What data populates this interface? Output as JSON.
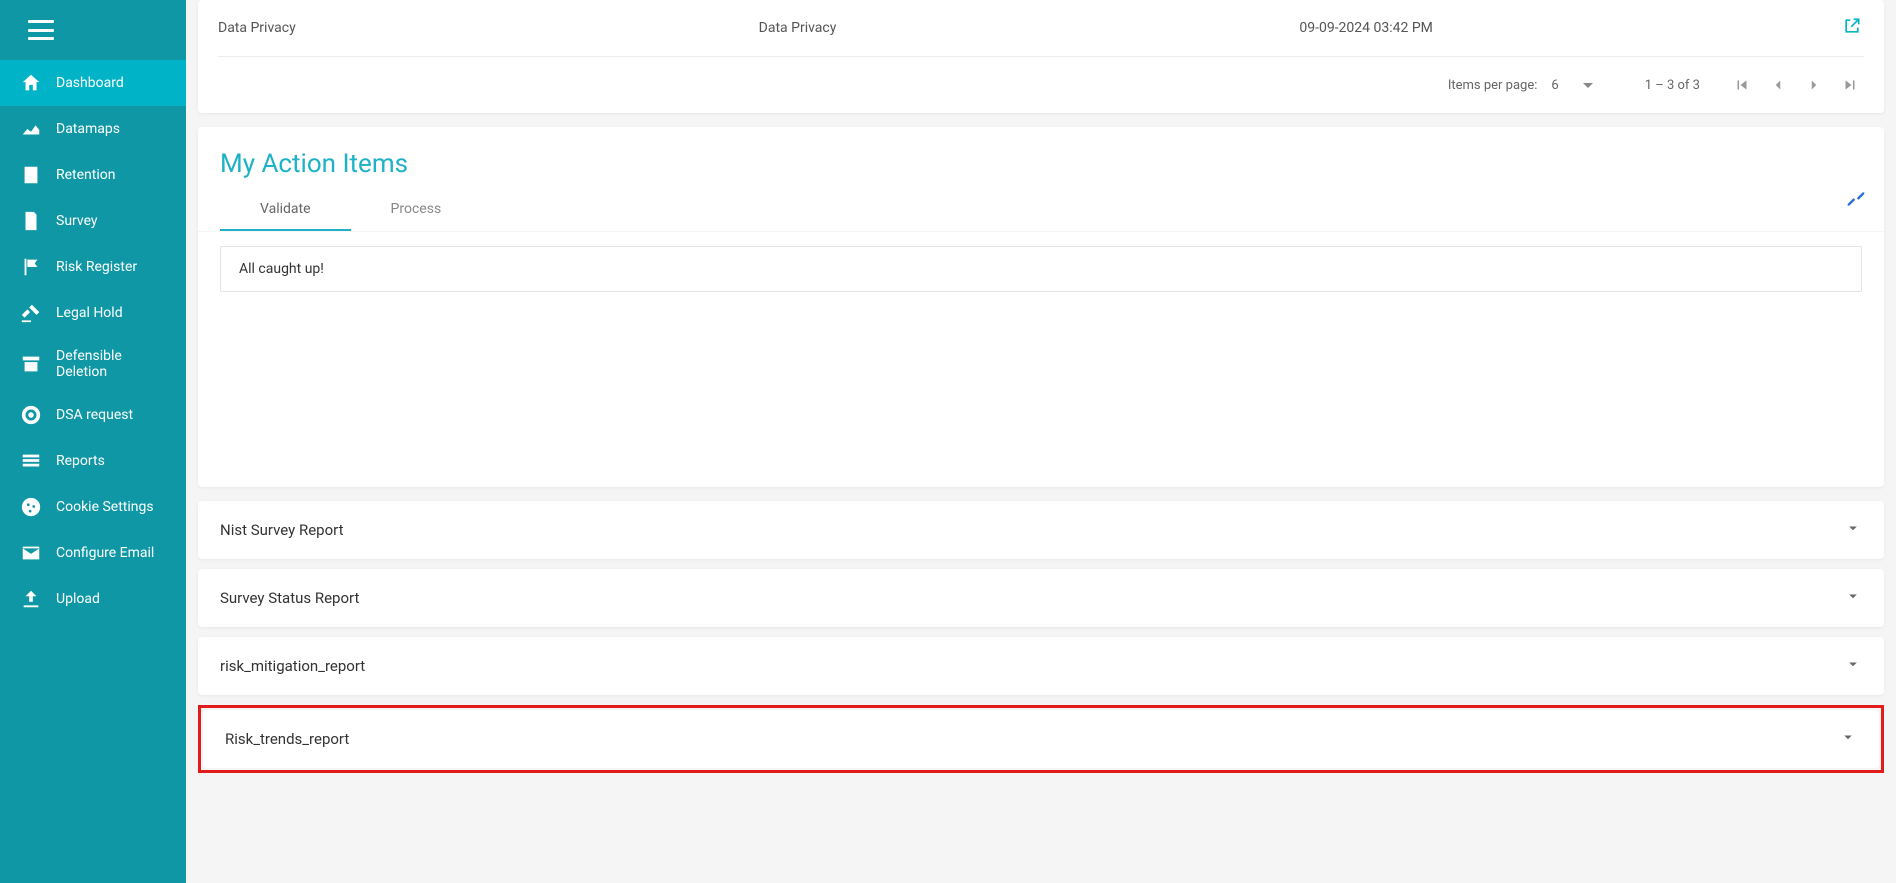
{
  "sidebar": {
    "items": [
      {
        "label": "Dashboard"
      },
      {
        "label": "Datamaps"
      },
      {
        "label": "Retention"
      },
      {
        "label": "Survey"
      },
      {
        "label": "Risk Register"
      },
      {
        "label": "Legal Hold"
      },
      {
        "label": "Defensible Deletion"
      },
      {
        "label": "DSA request"
      },
      {
        "label": "Reports"
      },
      {
        "label": "Cookie Settings"
      },
      {
        "label": "Configure Email"
      },
      {
        "label": "Upload"
      }
    ]
  },
  "top_row": {
    "col1": "Data Privacy",
    "col2": "Data Privacy",
    "col3": "09-09-2024 03:42 PM"
  },
  "paginator": {
    "label": "Items per page:",
    "value": "6",
    "range": "1 – 3 of 3"
  },
  "action_items": {
    "title": "My Action Items",
    "tabs": {
      "validate": "Validate",
      "process": "Process"
    },
    "message": "All caught up!"
  },
  "accordions": {
    "a1": "Nist Survey Report",
    "a2": "Survey Status Report",
    "a3": "risk_mitigation_report",
    "a4": "Risk_trends_report"
  }
}
